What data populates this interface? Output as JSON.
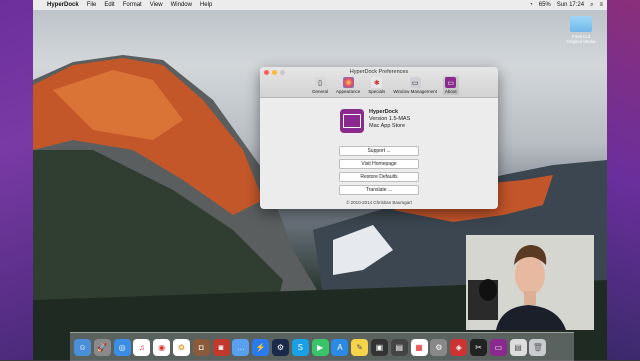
{
  "menubar": {
    "app_name": "HyperDock",
    "items": [
      "File",
      "Edit",
      "Format",
      "View",
      "Window",
      "Help"
    ],
    "battery": "65%",
    "clock": "Sun 17:24"
  },
  "desktop_icon": {
    "label": "Final Cut Original Media"
  },
  "window": {
    "title": "HyperDock Preferences",
    "tabs": [
      {
        "label": "General",
        "icon": "general-icon"
      },
      {
        "label": "Appearance",
        "icon": "appearance-icon"
      },
      {
        "label": "Specials",
        "icon": "specials-icon"
      },
      {
        "label": "Window Management",
        "icon": "window-management-icon"
      },
      {
        "label": "About",
        "icon": "about-icon"
      }
    ],
    "selected_tab": "About",
    "about": {
      "app_name": "HyperDock",
      "version": "Version 1.5-MAS",
      "store": "Mac App Store"
    },
    "buttons": [
      "Support ...",
      "Visit Homepage",
      "Restore Defaults",
      "Translate ..."
    ],
    "copyright": "© 2010-2014 Christian Baumgart"
  },
  "dock": {
    "apps": [
      "finder",
      "launchpad",
      "safari",
      "itunes",
      "chrome",
      "photos",
      "instagram",
      "photo-booth",
      "messages",
      "messenger",
      "steam",
      "skype",
      "facetime",
      "app-store",
      "notes",
      "photos-2",
      "mission-control",
      "calendar",
      "system-preferences",
      "preview",
      "final-cut",
      "hyperdock",
      "documents",
      "trash"
    ]
  }
}
